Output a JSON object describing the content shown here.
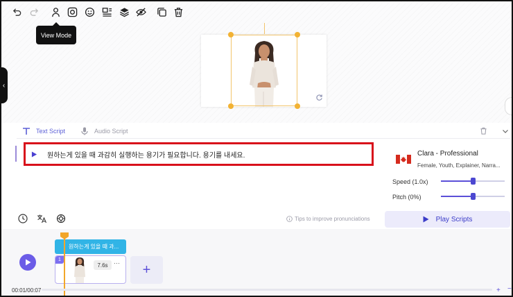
{
  "toolbar": {
    "items": [
      "undo-icon",
      "redo-icon",
      "view-mode-icon",
      "face-scan-icon",
      "emoji-icon",
      "align-icon",
      "layers-icon",
      "hide-icon",
      "copy-icon",
      "delete-icon"
    ],
    "tooltip": "View Mode"
  },
  "script": {
    "tabs": {
      "text": "Text Script",
      "audio": "Audio Script"
    },
    "text": "원하는게 있을 때 과감히 실행하는 용기가 필요합니다. 용기를 내세요."
  },
  "voice": {
    "name": "Clara - Professional",
    "description": "Female, Youth, Explainer, Narra...",
    "flag": "canada-flag"
  },
  "sliders": {
    "speed": {
      "label": "Speed (1.0x)",
      "value": 0.5
    },
    "pitch": {
      "label": "Pitch (0%)",
      "value": 0.5
    }
  },
  "tools": {
    "tip": "Tips to improve pronunciations",
    "play_scripts": "Play Scripts"
  },
  "timeline": {
    "time": "00:01/00:07",
    "script_chip": "원하는게 있을 때 과...",
    "scene_number": "1",
    "scene_duration": "7.6s",
    "scene_more": "···",
    "add_label": "+",
    "zoom_plus": "+",
    "zoom_minus": "−"
  },
  "colors": {
    "accent": "#5b4fd8",
    "highlight_border": "#d8101b",
    "selection": "#f2b233",
    "chip": "#31b4e6"
  }
}
